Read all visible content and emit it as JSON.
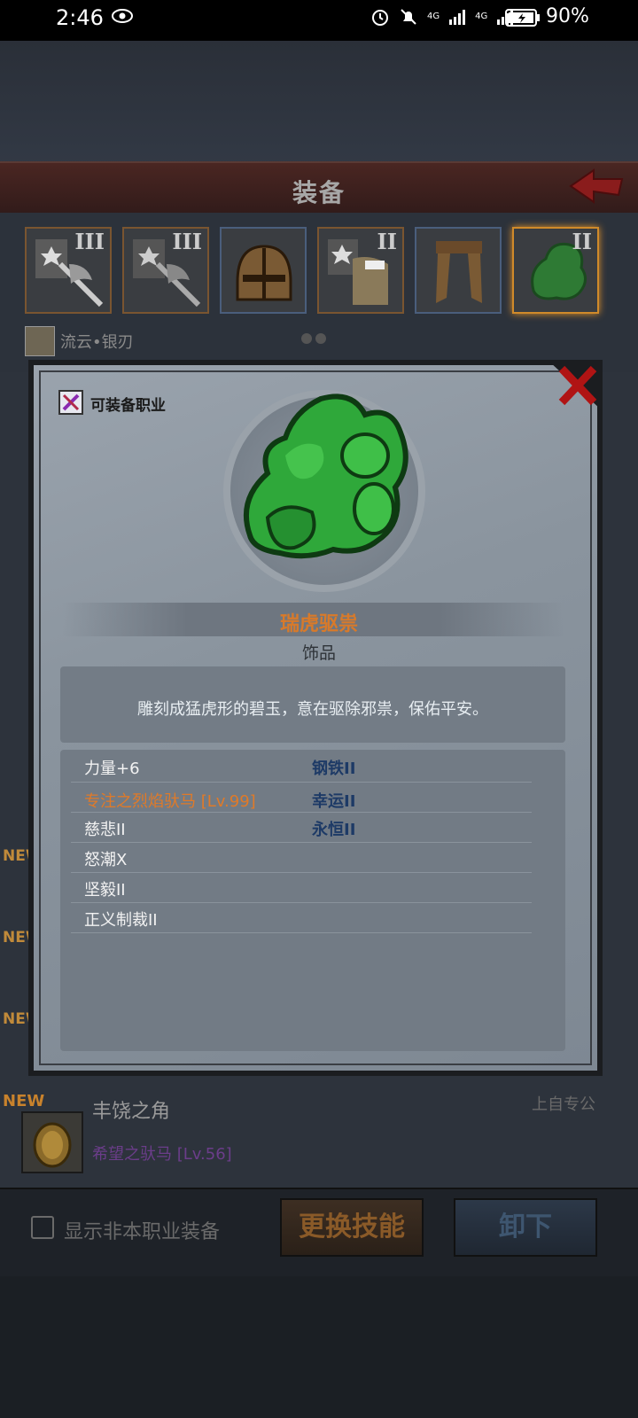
{
  "status_bar": {
    "time": "2:46",
    "net1": "4G",
    "net2": "4G",
    "battery": "90%"
  },
  "header": {
    "title": "装备"
  },
  "equipment_slots": [
    {
      "rank": "III",
      "icon": "axe-emblem-icon"
    },
    {
      "rank": "III",
      "icon": "axe-emblem-icon"
    },
    {
      "rank": "",
      "icon": "helmet-icon"
    },
    {
      "rank": "II",
      "icon": "armor-emblem-icon"
    },
    {
      "rank": "",
      "icon": "leg-armor-icon"
    },
    {
      "rank": "II",
      "icon": "jade-tiger-icon"
    }
  ],
  "hero": {
    "name": "流云•银刃"
  },
  "side_labels": {
    "new": "NEW"
  },
  "list_item": {
    "new": "NEW",
    "name": "丰饶之角",
    "skill": "希望之驮马 [Lv.56]",
    "right": "上自专公"
  },
  "bottom": {
    "checkbox_label": "显示非本职业装备",
    "change_skill": "更换技能",
    "unequip": "卸下"
  },
  "modal": {
    "job_label": "可装备职业",
    "item_name": "瑞虎驱祟",
    "item_type": "饰品",
    "description": "雕刻成猛虎形的碧玉，意在驱除邪祟，保佑平安。",
    "attributes_left": [
      {
        "text": "力量+6",
        "style": "white"
      },
      {
        "text": "专注之烈焰驮马 [Lv.99]",
        "style": "orange"
      },
      {
        "text": "慈悲II",
        "style": "white"
      },
      {
        "text": "怒潮X",
        "style": "white"
      },
      {
        "text": "坚毅II",
        "style": "white"
      },
      {
        "text": "正义制裁II",
        "style": "white"
      }
    ],
    "attributes_right": [
      {
        "text": "钢铁II",
        "style": "blue"
      },
      {
        "text": "幸运II",
        "style": "blue"
      },
      {
        "text": "永恒II",
        "style": "blue"
      }
    ]
  },
  "colors": {
    "accent_orange": "#e07a28",
    "attr_blue": "#1d3a66",
    "jade_green": "#2fa83a"
  }
}
